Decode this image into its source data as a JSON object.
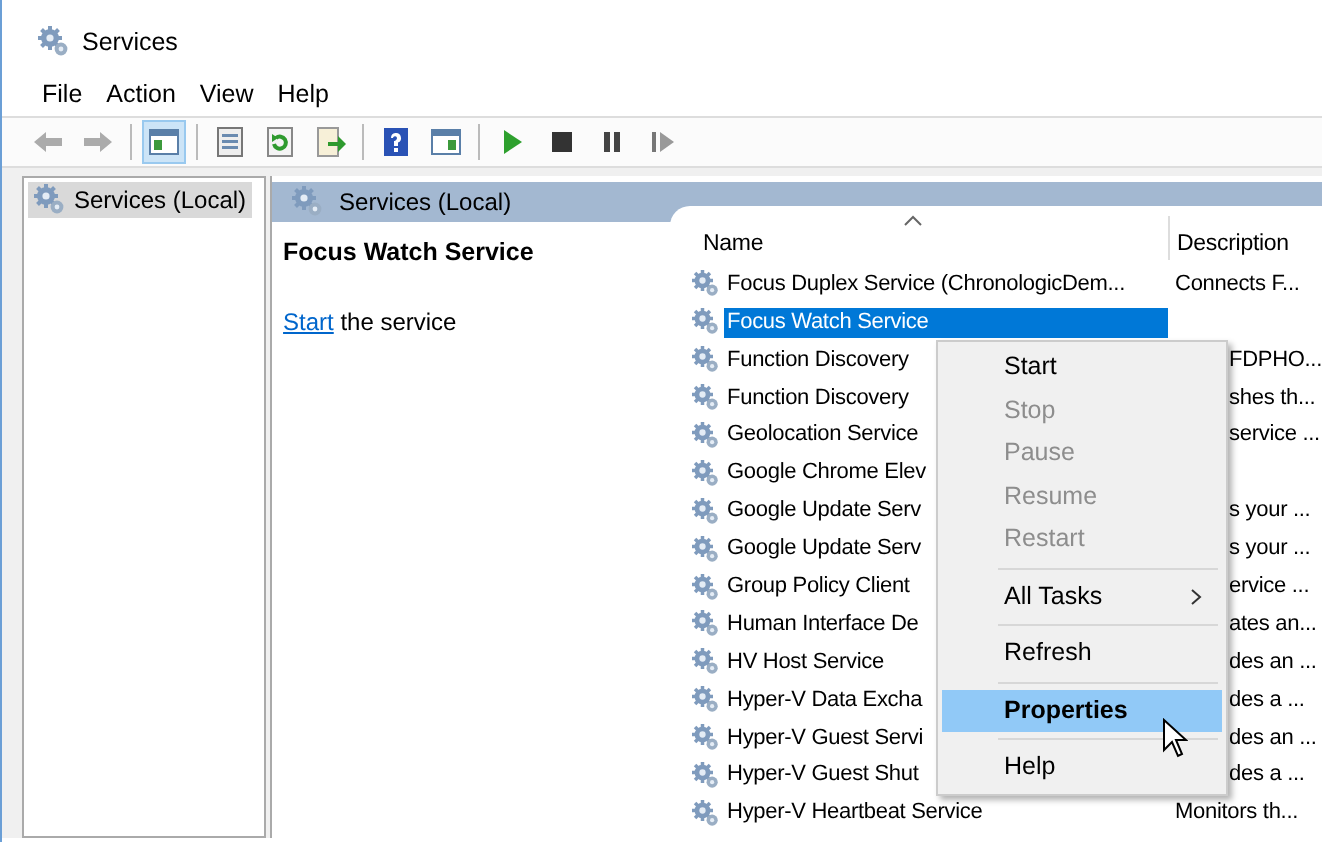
{
  "window": {
    "title": "Services"
  },
  "menu": [
    "File",
    "Action",
    "View",
    "Help"
  ],
  "toolbar": [
    {
      "kind": "back",
      "disabled": true,
      "pressed": false
    },
    {
      "kind": "forward",
      "disabled": true,
      "pressed": false
    },
    {
      "kind": "separator"
    },
    {
      "kind": "console-tree",
      "disabled": false,
      "pressed": true
    },
    {
      "kind": "separator"
    },
    {
      "kind": "properties",
      "disabled": false,
      "pressed": false
    },
    {
      "kind": "refresh",
      "disabled": false,
      "pressed": false
    },
    {
      "kind": "export",
      "disabled": false,
      "pressed": false
    },
    {
      "kind": "separator"
    },
    {
      "kind": "help",
      "disabled": false,
      "pressed": false
    },
    {
      "kind": "action-pane",
      "disabled": false,
      "pressed": false
    },
    {
      "kind": "separator"
    },
    {
      "kind": "play",
      "disabled": false,
      "pressed": false
    },
    {
      "kind": "stop",
      "disabled": false,
      "pressed": false
    },
    {
      "kind": "pause",
      "disabled": false,
      "pressed": false
    },
    {
      "kind": "resume",
      "disabled": false,
      "pressed": false
    }
  ],
  "tree": [
    {
      "label": "Services (Local)",
      "selected": true
    }
  ],
  "pane": {
    "title": "Services (Local)",
    "service_name": "Focus Watch Service",
    "action_link": "Start",
    "action_text": " the service"
  },
  "table": {
    "columns": [
      "Name",
      "Description"
    ],
    "rows": [
      {
        "name": "Focus Duplex Service (ChronologicDem...",
        "description": "Connects F...",
        "selected": false,
        "covered": false
      },
      {
        "name": "Focus Watch Service",
        "selected": true
      },
      {
        "name": "Function Discovery",
        "description": "FDPHO...",
        "selected": false,
        "covered": true
      },
      {
        "name": "Function Discovery",
        "description": "shes th...",
        "selected": false,
        "covered": true
      },
      {
        "name": "Geolocation Service",
        "description": "service ...",
        "selected": false,
        "covered": true
      },
      {
        "name": "Google Chrome Elev",
        "selected": false
      },
      {
        "name": "Google Update Serv",
        "description": "s your ...",
        "selected": false,
        "covered": true
      },
      {
        "name": "Google Update Serv",
        "description": "s your ...",
        "selected": false,
        "covered": true
      },
      {
        "name": "Group Policy Client",
        "description": "ervice ...",
        "selected": false,
        "covered": true
      },
      {
        "name": "Human Interface De",
        "description": "ates an...",
        "selected": false,
        "covered": true
      },
      {
        "name": "HV Host Service",
        "description": "des an ...",
        "selected": false,
        "covered": true
      },
      {
        "name": "Hyper-V Data Excha",
        "description": "des a ...",
        "selected": false,
        "covered": true
      },
      {
        "name": "Hyper-V Guest Servi",
        "description": "des an ...",
        "selected": false,
        "covered": true
      },
      {
        "name": "Hyper-V Guest Shut",
        "description": "des a ...",
        "selected": false,
        "covered": true
      },
      {
        "name": "Hyper-V Heartbeat Service",
        "description": "Monitors th...",
        "selected": false,
        "covered": false
      }
    ]
  },
  "context_menu": [
    {
      "kind": "item",
      "label": "Start",
      "disabled": false,
      "selected": false,
      "submenu": false
    },
    {
      "kind": "item",
      "label": "Stop",
      "disabled": true,
      "selected": false,
      "submenu": false
    },
    {
      "kind": "item",
      "label": "Pause",
      "disabled": true,
      "selected": false,
      "submenu": false
    },
    {
      "kind": "item",
      "label": "Resume",
      "disabled": true,
      "selected": false,
      "submenu": false
    },
    {
      "kind": "item",
      "label": "Restart",
      "disabled": true,
      "selected": false,
      "submenu": false
    },
    {
      "kind": "separator"
    },
    {
      "kind": "item",
      "label": "All Tasks",
      "disabled": false,
      "selected": false,
      "submenu": true
    },
    {
      "kind": "separator"
    },
    {
      "kind": "item",
      "label": "Refresh",
      "disabled": false,
      "selected": false,
      "submenu": false
    },
    {
      "kind": "separator"
    },
    {
      "kind": "item",
      "label": "Properties",
      "disabled": false,
      "selected": true,
      "submenu": false
    },
    {
      "kind": "separator"
    },
    {
      "kind": "item",
      "label": "Help",
      "disabled": false,
      "selected": false,
      "submenu": false
    }
  ]
}
